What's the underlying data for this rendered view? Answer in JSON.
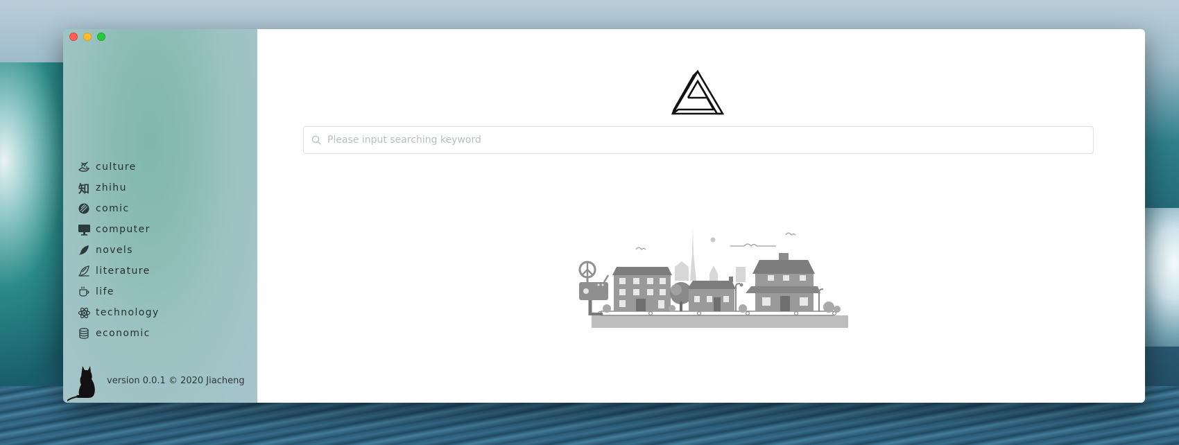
{
  "sidebar": {
    "items": [
      {
        "label": "culture",
        "icon": "dragon-icon"
      },
      {
        "label": "zhihu",
        "icon": "zhihu-icon"
      },
      {
        "label": "comic",
        "icon": "comic-icon"
      },
      {
        "label": "computer",
        "icon": "monitor-icon"
      },
      {
        "label": "novels",
        "icon": "quill-icon"
      },
      {
        "label": "literature",
        "icon": "feather-pen-icon"
      },
      {
        "label": "life",
        "icon": "coffee-cup-icon"
      },
      {
        "label": "technology",
        "icon": "atom-icon"
      },
      {
        "label": "economic",
        "icon": "coin-stack-icon"
      }
    ],
    "zhihu_glyph": "知",
    "footer": {
      "version": "version 0.0.1 © 2020 Jiacheng"
    }
  },
  "search": {
    "placeholder": "Please input searching keyword",
    "value": ""
  },
  "colors": {
    "close": "#fe5f57",
    "minimize": "#febc2e",
    "zoom": "#28c840",
    "illustration": "#8f8f8f"
  }
}
